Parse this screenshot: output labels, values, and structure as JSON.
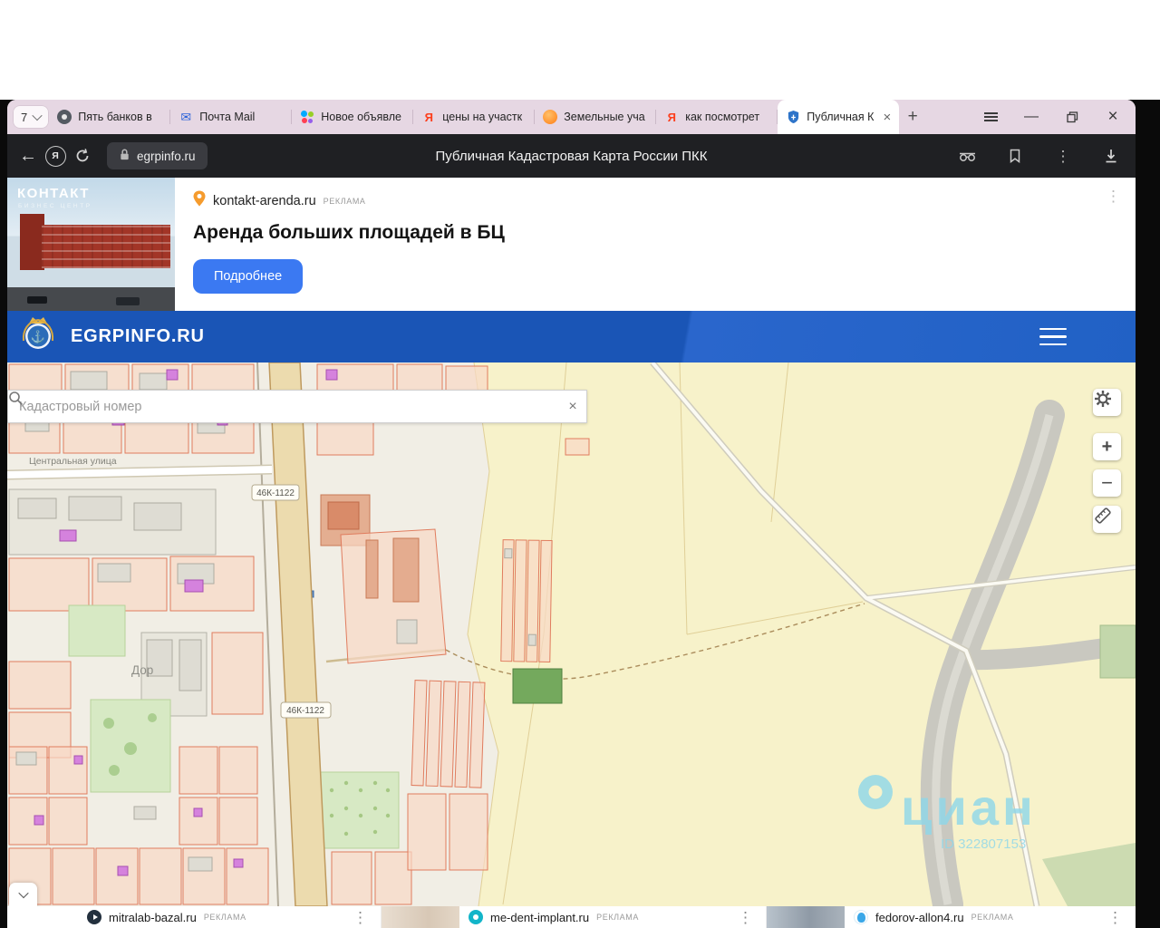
{
  "browser": {
    "tab_counter": "7",
    "tabs": [
      {
        "label": "Пять банков в"
      },
      {
        "label": "Почта Mail"
      },
      {
        "label": "Новое объявле"
      },
      {
        "label": "цены на участк"
      },
      {
        "label": "Земельные уча"
      },
      {
        "label": "как посмотрет"
      },
      {
        "label": "Публичная К"
      }
    ],
    "url": "egrpinfo.ru",
    "page_title": "Публичная Кадастровая Карта России ПКК"
  },
  "glyphs": {
    "back": "←",
    "close": "×",
    "minimize": "—",
    "new_tab": "+",
    "kebab": "⋮",
    "ya": "Я",
    "mail": "✉",
    "anchor": "⚓",
    "clear": "×"
  },
  "top_ad": {
    "advertiser": "kontakt-arenda.ru",
    "ad_badge": "РЕКЛАМА",
    "headline": "Аренда больших площадей в БЦ",
    "cta": "Подробнее",
    "image_line1": "КОНТАКТ",
    "image_line2": "БИЗНЕС ЦЕНТР"
  },
  "site": {
    "brand": "EGRPINFO.RU"
  },
  "map": {
    "search_placeholder": "Кадастровый номер",
    "street_label": "Центральная улица",
    "road_badge": "46К-1122",
    "settlement_label": "Дор",
    "watermark_text": "циан",
    "watermark_id": "ID 322807153",
    "zoom_in": "+",
    "zoom_out": "−"
  },
  "bottom_ads": {
    "ad_badge": "РЕКЛАМА",
    "items": [
      {
        "advertiser": "mitralab-bazal.ru"
      },
      {
        "advertiser": "me-dent-implant.ru"
      },
      {
        "advertiser": "fedorov-allon4.ru"
      }
    ]
  },
  "colors": {
    "header_blue": "#1a55b6",
    "cta_blue": "#3b79f2",
    "watermark_cyan": "#8ed7ea",
    "tabbar_lavender": "#e6d7e3"
  }
}
